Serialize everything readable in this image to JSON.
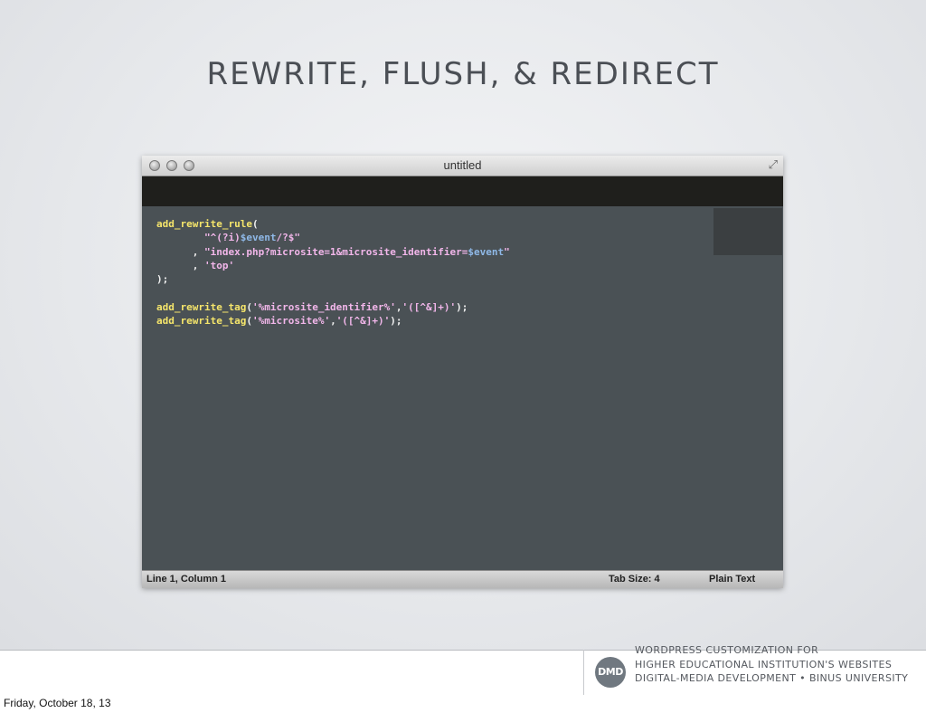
{
  "slide": {
    "title": "Rewrite, Flush, & Redirect"
  },
  "window": {
    "title": "untitled",
    "code": {
      "l1_fn": "add_rewrite_rule",
      "l1_paren": "(",
      "l2_indent": "        ",
      "l2_str_a": "\"^(?i)",
      "l2_var": "$event",
      "l2_str_b": "/?$\"",
      "l3_prefix": "      , ",
      "l3_str": "\"index.php?microsite=1&microsite_identifier=",
      "l3_var": "$event",
      "l3_str_end": "\"",
      "l4_prefix": "      , ",
      "l4_str": "'top'",
      "l5": ");",
      "l7_fn": "add_rewrite_tag",
      "l7_open": "(",
      "l7_str_a": "'%microsite_identifier%'",
      "l7_comma": ",",
      "l7_str_b": "'([^&]+)'",
      "l7_close": ");",
      "l8_fn": "add_rewrite_tag",
      "l8_open": "(",
      "l8_str_a": "'%microsite%'",
      "l8_comma": ",",
      "l8_str_b": "'([^&]+)'",
      "l8_close": ");"
    },
    "status": {
      "position": "Line 1, Column 1",
      "tab_size": "Tab Size: 4",
      "syntax": "Plain Text"
    },
    "icons": {
      "close": "traffic-light-close-icon",
      "minimize": "traffic-light-minimize-icon",
      "zoom": "traffic-light-zoom-icon",
      "fullscreen": "fullscreen-arrows-icon"
    }
  },
  "footer": {
    "logo_text": "DMD",
    "line1": "WordPress Customization for",
    "line2": "Higher Educational Institution's Websites",
    "line3": "Digital-Media Development • Binus University"
  },
  "date": "Friday, October 18, 13",
  "colors": {
    "editor_bg": "#4a5155",
    "tabbar_bg": "#1f1f1c",
    "function_color": "#f5e56b",
    "string_color": "#f2b6ea",
    "variable_color": "#8fb9e8"
  }
}
